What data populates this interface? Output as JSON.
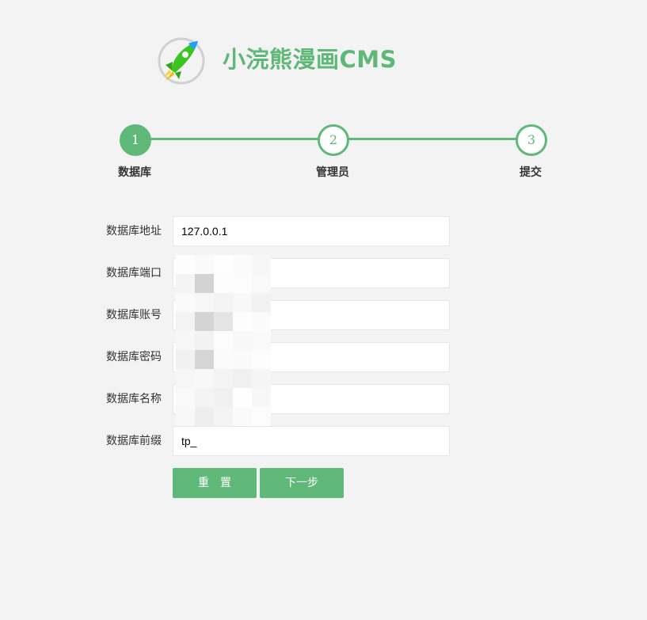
{
  "brand": {
    "title": "小浣熊漫画CMS",
    "logo_icon": "rocket-icon",
    "accent_color": "#5fb878"
  },
  "steps": [
    {
      "number": "1",
      "label": "数据库",
      "active": true
    },
    {
      "number": "2",
      "label": "管理员",
      "active": false
    },
    {
      "number": "3",
      "label": "提交",
      "active": false
    }
  ],
  "form": {
    "fields": [
      {
        "label": "数据库地址",
        "value": "127.0.0.1"
      },
      {
        "label": "数据库端口",
        "value": ""
      },
      {
        "label": "数据库账号",
        "value": ""
      },
      {
        "label": "数据库密码",
        "value": ""
      },
      {
        "label": "数据库名称",
        "value": ""
      },
      {
        "label": "数据库前缀",
        "value": "tp_"
      }
    ]
  },
  "buttons": {
    "reset_label": "重　置",
    "next_label": "下一步"
  }
}
